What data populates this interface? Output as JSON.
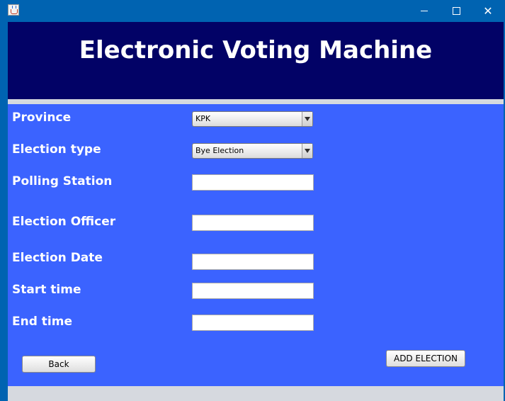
{
  "window": {
    "title": "",
    "icon": "java-cup-icon",
    "controls": [
      "minimize-icon",
      "maximize-icon",
      "close-icon"
    ],
    "close_glyph": "✕"
  },
  "header": {
    "title": "Electronic Voting Machine",
    "background": "#020266"
  },
  "form": {
    "background": "#3b63ff",
    "province": {
      "label": "Province",
      "value": "KPK"
    },
    "election_type": {
      "label": "Election type",
      "value": "Bye Election"
    },
    "polling_station": {
      "label": "Polling Station",
      "value": ""
    },
    "election_officer": {
      "label": "Election Officer",
      "value": ""
    },
    "election_date": {
      "label": "Election Date",
      "value": ""
    },
    "start_time": {
      "label": "Start time",
      "value": ""
    },
    "end_time": {
      "label": "End time",
      "value": ""
    }
  },
  "buttons": {
    "back": "Back",
    "add_election": "ADD ELECTION"
  }
}
